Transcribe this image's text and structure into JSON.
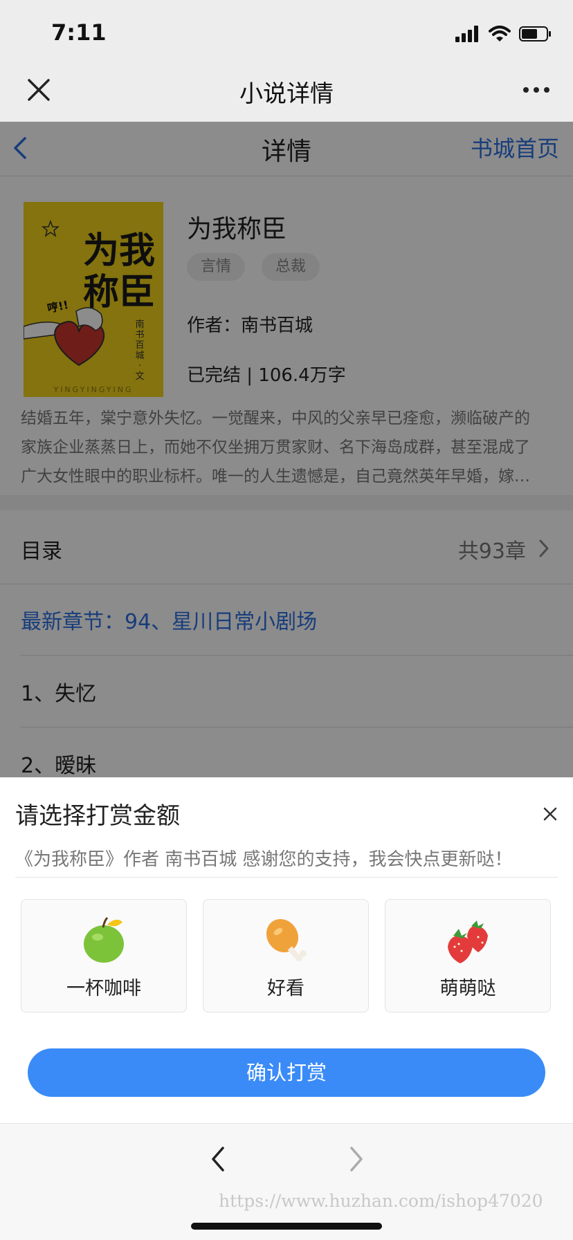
{
  "status_bar": {
    "time": "7:11"
  },
  "wechat_nav": {
    "title": "小说详情"
  },
  "header": {
    "title": "详情",
    "home_link": "书城首页"
  },
  "cover": {
    "title_line1": "为我",
    "title_line2": "称臣",
    "vertical_text": [
      "南",
      "书",
      "百",
      "城",
      "·",
      "文"
    ],
    "footer": "YINGYINGYING",
    "exclaim": "哼!!"
  },
  "book": {
    "title": "为我称臣",
    "tags": [
      "言情",
      "总裁"
    ],
    "author": "作者：南书百城",
    "status": "已完结 | 106.4万字",
    "description_lines": [
      "结婚五年，棠宁意外失忆。一觉醒来，中风的父亲早已痊愈，濒临破产的",
      "家族企业蒸蒸日上，而她不仅坐拥万贯家财、名下海岛成群，甚至混成了",
      "广大女性眼中的职业标杆。唯一的人生遗憾是，自己竟然英年早婚，嫁…"
    ]
  },
  "toc": {
    "label": "目录",
    "count": "共93章",
    "latest": "最新章节：94、星川日常小剧场",
    "chapters": [
      "1、失忆",
      "2、暧昧"
    ]
  },
  "reward": {
    "title": "请选择打赏金额",
    "thanks": "《为我称臣》作者 南书百城 感谢您的支持，我会快点更新哒！",
    "options": [
      {
        "label": "一杯咖啡",
        "icon": "apple-icon"
      },
      {
        "label": "好看",
        "icon": "drumstick-icon"
      },
      {
        "label": "萌萌哒",
        "icon": "strawberry-icon"
      }
    ],
    "confirm": "确认打赏"
  },
  "footer": {
    "watermark": "https://www.huzhan.com/ishop47020"
  }
}
